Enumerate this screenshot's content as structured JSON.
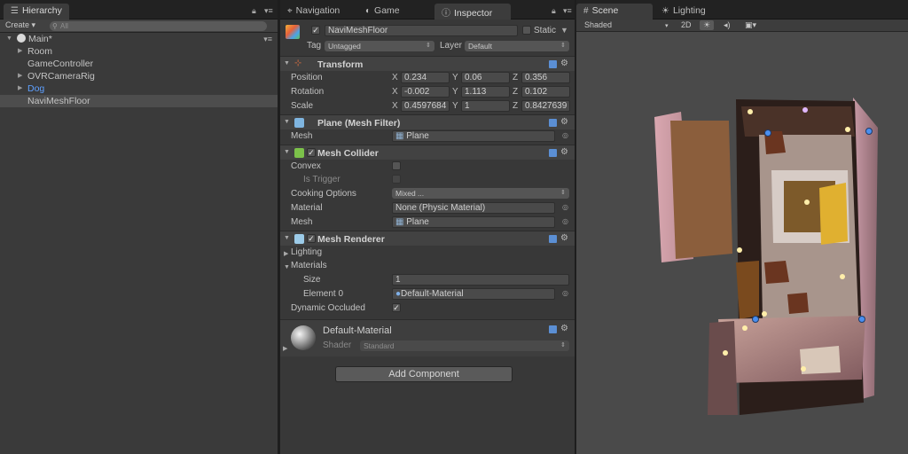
{
  "hierarchy": {
    "tab": "Hierarchy",
    "create_label": "Create",
    "search_placeholder": "All",
    "items": [
      {
        "label": "Main*"
      },
      {
        "label": "Room"
      },
      {
        "label": "GameController"
      },
      {
        "label": "OVRCameraRig"
      },
      {
        "label": "Dog"
      },
      {
        "label": "NaviMeshFloor"
      }
    ]
  },
  "center_tabs": {
    "navigation": "Navigation",
    "game": "Game",
    "inspector": "Inspector"
  },
  "inspector": {
    "object_name": "NaviMeshFloor",
    "static_label": "Static",
    "tag_label": "Tag",
    "tag_value": "Untagged",
    "layer_label": "Layer",
    "layer_value": "Default",
    "transform": {
      "title": "Transform",
      "position_label": "Position",
      "rotation_label": "Rotation",
      "scale_label": "Scale",
      "axis_x": "X",
      "axis_y": "Y",
      "axis_z": "Z",
      "position": {
        "x": "0.234",
        "y": "0.06",
        "z": "0.356"
      },
      "rotation": {
        "x": "-0.002",
        "y": "1.113",
        "z": "0.102"
      },
      "scale": {
        "x": "0.4597684",
        "y": "1",
        "z": "0.8427639"
      }
    },
    "mesh_filter": {
      "title": "Plane (Mesh Filter)",
      "mesh_label": "Mesh",
      "mesh_value": "Plane"
    },
    "mesh_collider": {
      "title": "Mesh Collider",
      "convex_label": "Convex",
      "is_trigger_label": "Is Trigger",
      "cooking_label": "Cooking Options",
      "cooking_value": "Mixed ...",
      "material_label": "Material",
      "material_value": "None (Physic Material)",
      "mesh_label": "Mesh",
      "mesh_value": "Plane"
    },
    "mesh_renderer": {
      "title": "Mesh Renderer",
      "lighting_label": "Lighting",
      "materials_label": "Materials",
      "size_label": "Size",
      "size_value": "1",
      "element0_label": "Element 0",
      "element0_value": "Default-Material",
      "dynamic_occluded_label": "Dynamic Occluded"
    },
    "material": {
      "name": "Default-Material",
      "shader_label": "Shader",
      "shader_value": "Standard"
    },
    "add_component": "Add Component"
  },
  "scene": {
    "tab": "Scene",
    "lighting_tab": "Lighting",
    "shading_mode": "Shaded",
    "mode_2d": "2D"
  },
  "colors": {
    "accent_blue": "#5ea0ff",
    "panel_bg": "#383838"
  }
}
